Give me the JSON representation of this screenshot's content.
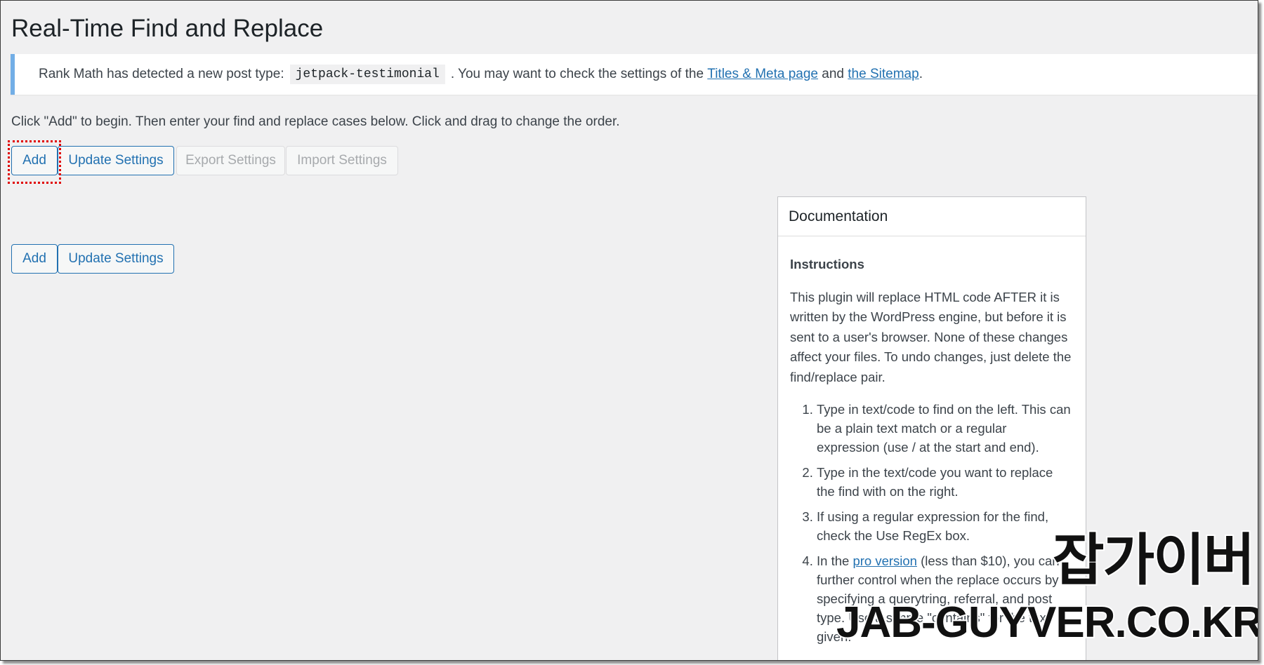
{
  "page": {
    "title": "Real-Time Find and Replace"
  },
  "notice": {
    "text_before": "Rank Math has detected a new post type:",
    "code": "jetpack-testimonial",
    "text_middle": ". You may want to check the settings of the",
    "link1": "Titles & Meta page",
    "text_and": "and",
    "link2": "the Sitemap",
    "text_end": "."
  },
  "intro": "Click \"Add\" to begin. Then enter your find and replace cases below. Click and drag to change the order.",
  "toolbar_top": {
    "add": "Add",
    "update": "Update Settings",
    "export": "Export Settings",
    "import": "Import Settings"
  },
  "toolbar_bottom": {
    "add": "Add",
    "update": "Update Settings"
  },
  "documentation": {
    "title": "Documentation",
    "heading": "Instructions",
    "paragraph": "This plugin will replace HTML code AFTER it is written by the WordPress engine, but before it is sent to a user's browser. None of these changes affect your files. To undo changes, just delete the find/replace pair.",
    "steps": [
      "Type in text/code to find on the left. This can be a plain text match or a regular expression (use / at the start and end).",
      "Type in the text/code you want to replace the find with on the right.",
      "If using a regular expression for the find, check the Use RegEx box."
    ],
    "step4": {
      "before": "In the",
      "link": "pro version",
      "after": "(less than $10), you can further control when the replace occurs by specifying a querytring, referral, and post type. Use a simple \"contains\" for the text given."
    }
  },
  "watermark": {
    "korean": "잡가이버",
    "domain": "JAB-GUYVER.CO.KR"
  }
}
